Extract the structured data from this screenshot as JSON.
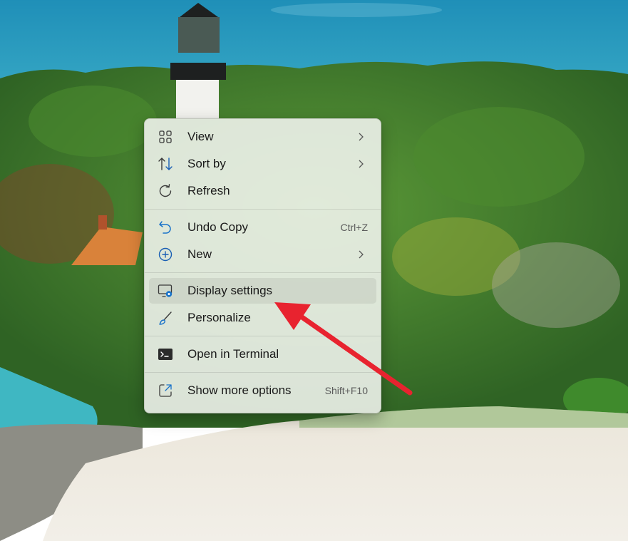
{
  "colors": {
    "sea": "#2a9bc0",
    "foliage": "#3f7a2c",
    "sand": "#ece8df",
    "menu_bg": "#f3f5f0",
    "accent_blue": "#1a73c9",
    "arrow_red": "#e8232f"
  },
  "context_menu": {
    "items": [
      {
        "label": "View",
        "icon": "grid-icon",
        "submenu": true
      },
      {
        "label": "Sort by",
        "icon": "sort-icon",
        "submenu": true
      },
      {
        "label": "Refresh",
        "icon": "refresh-icon"
      },
      {
        "label": "Undo Copy",
        "icon": "undo-icon",
        "shortcut": "Ctrl+Z"
      },
      {
        "label": "New",
        "icon": "plus-circle-icon",
        "submenu": true
      },
      {
        "label": "Display settings",
        "icon": "display-settings-icon",
        "highlighted": true
      },
      {
        "label": "Personalize",
        "icon": "brush-icon"
      },
      {
        "label": "Open in Terminal",
        "icon": "terminal-icon"
      },
      {
        "label": "Show more options",
        "icon": "show-more-icon",
        "shortcut": "Shift+F10"
      }
    ]
  },
  "annotation": {
    "type": "arrow",
    "points_to": "Display settings",
    "color": "#e8232f"
  }
}
